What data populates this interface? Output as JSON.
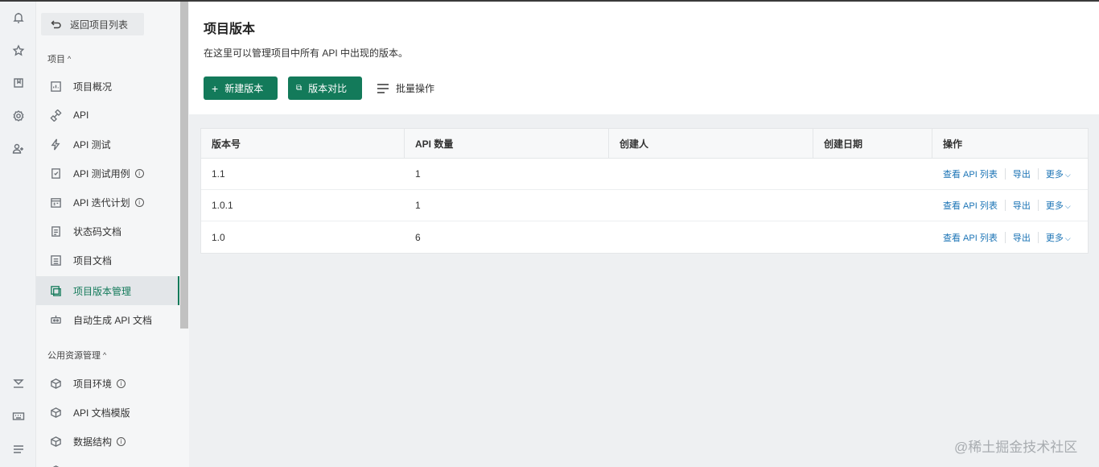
{
  "sidebar": {
    "back_label": "返回项目列表",
    "group1_title": "项目",
    "items": [
      {
        "label": "项目概况",
        "info": ""
      },
      {
        "label": "API",
        "info": ""
      },
      {
        "label": "API 测试",
        "info": ""
      },
      {
        "label": "API 测试用例",
        "info": "i"
      },
      {
        "label": "API 迭代计划",
        "info": "i"
      },
      {
        "label": "状态码文档",
        "info": ""
      },
      {
        "label": "项目文档",
        "info": ""
      },
      {
        "label": "项目版本管理",
        "info": ""
      },
      {
        "label": "自动生成 API 文档",
        "info": ""
      }
    ],
    "group2_title": "公用资源管理",
    "items2": [
      {
        "label": "项目环境",
        "info": "i"
      },
      {
        "label": "API 文档模版",
        "info": ""
      },
      {
        "label": "数据结构",
        "info": "i"
      }
    ]
  },
  "header": {
    "title": "项目版本",
    "description": "在这里可以管理项目中所有 API 中出现的版本。",
    "new_version": "新建版本",
    "compare": "版本对比",
    "batch": "批量操作"
  },
  "table": {
    "columns": [
      "版本号",
      "API 数量",
      "创建人",
      "创建日期",
      "操作"
    ],
    "rows": [
      {
        "version": "1.1",
        "api_count": "1",
        "creator": "",
        "date": ""
      },
      {
        "version": "1.0.1",
        "api_count": "1",
        "creator": "",
        "date": ""
      },
      {
        "version": "1.0",
        "api_count": "6",
        "creator": "",
        "date": ""
      }
    ],
    "actions": {
      "view": "查看 API 列表",
      "export": "导出",
      "more": "更多"
    }
  },
  "watermark": "@稀土掘金技术社区",
  "colors": {
    "accent": "#137a5a",
    "link": "#1a73b5"
  }
}
